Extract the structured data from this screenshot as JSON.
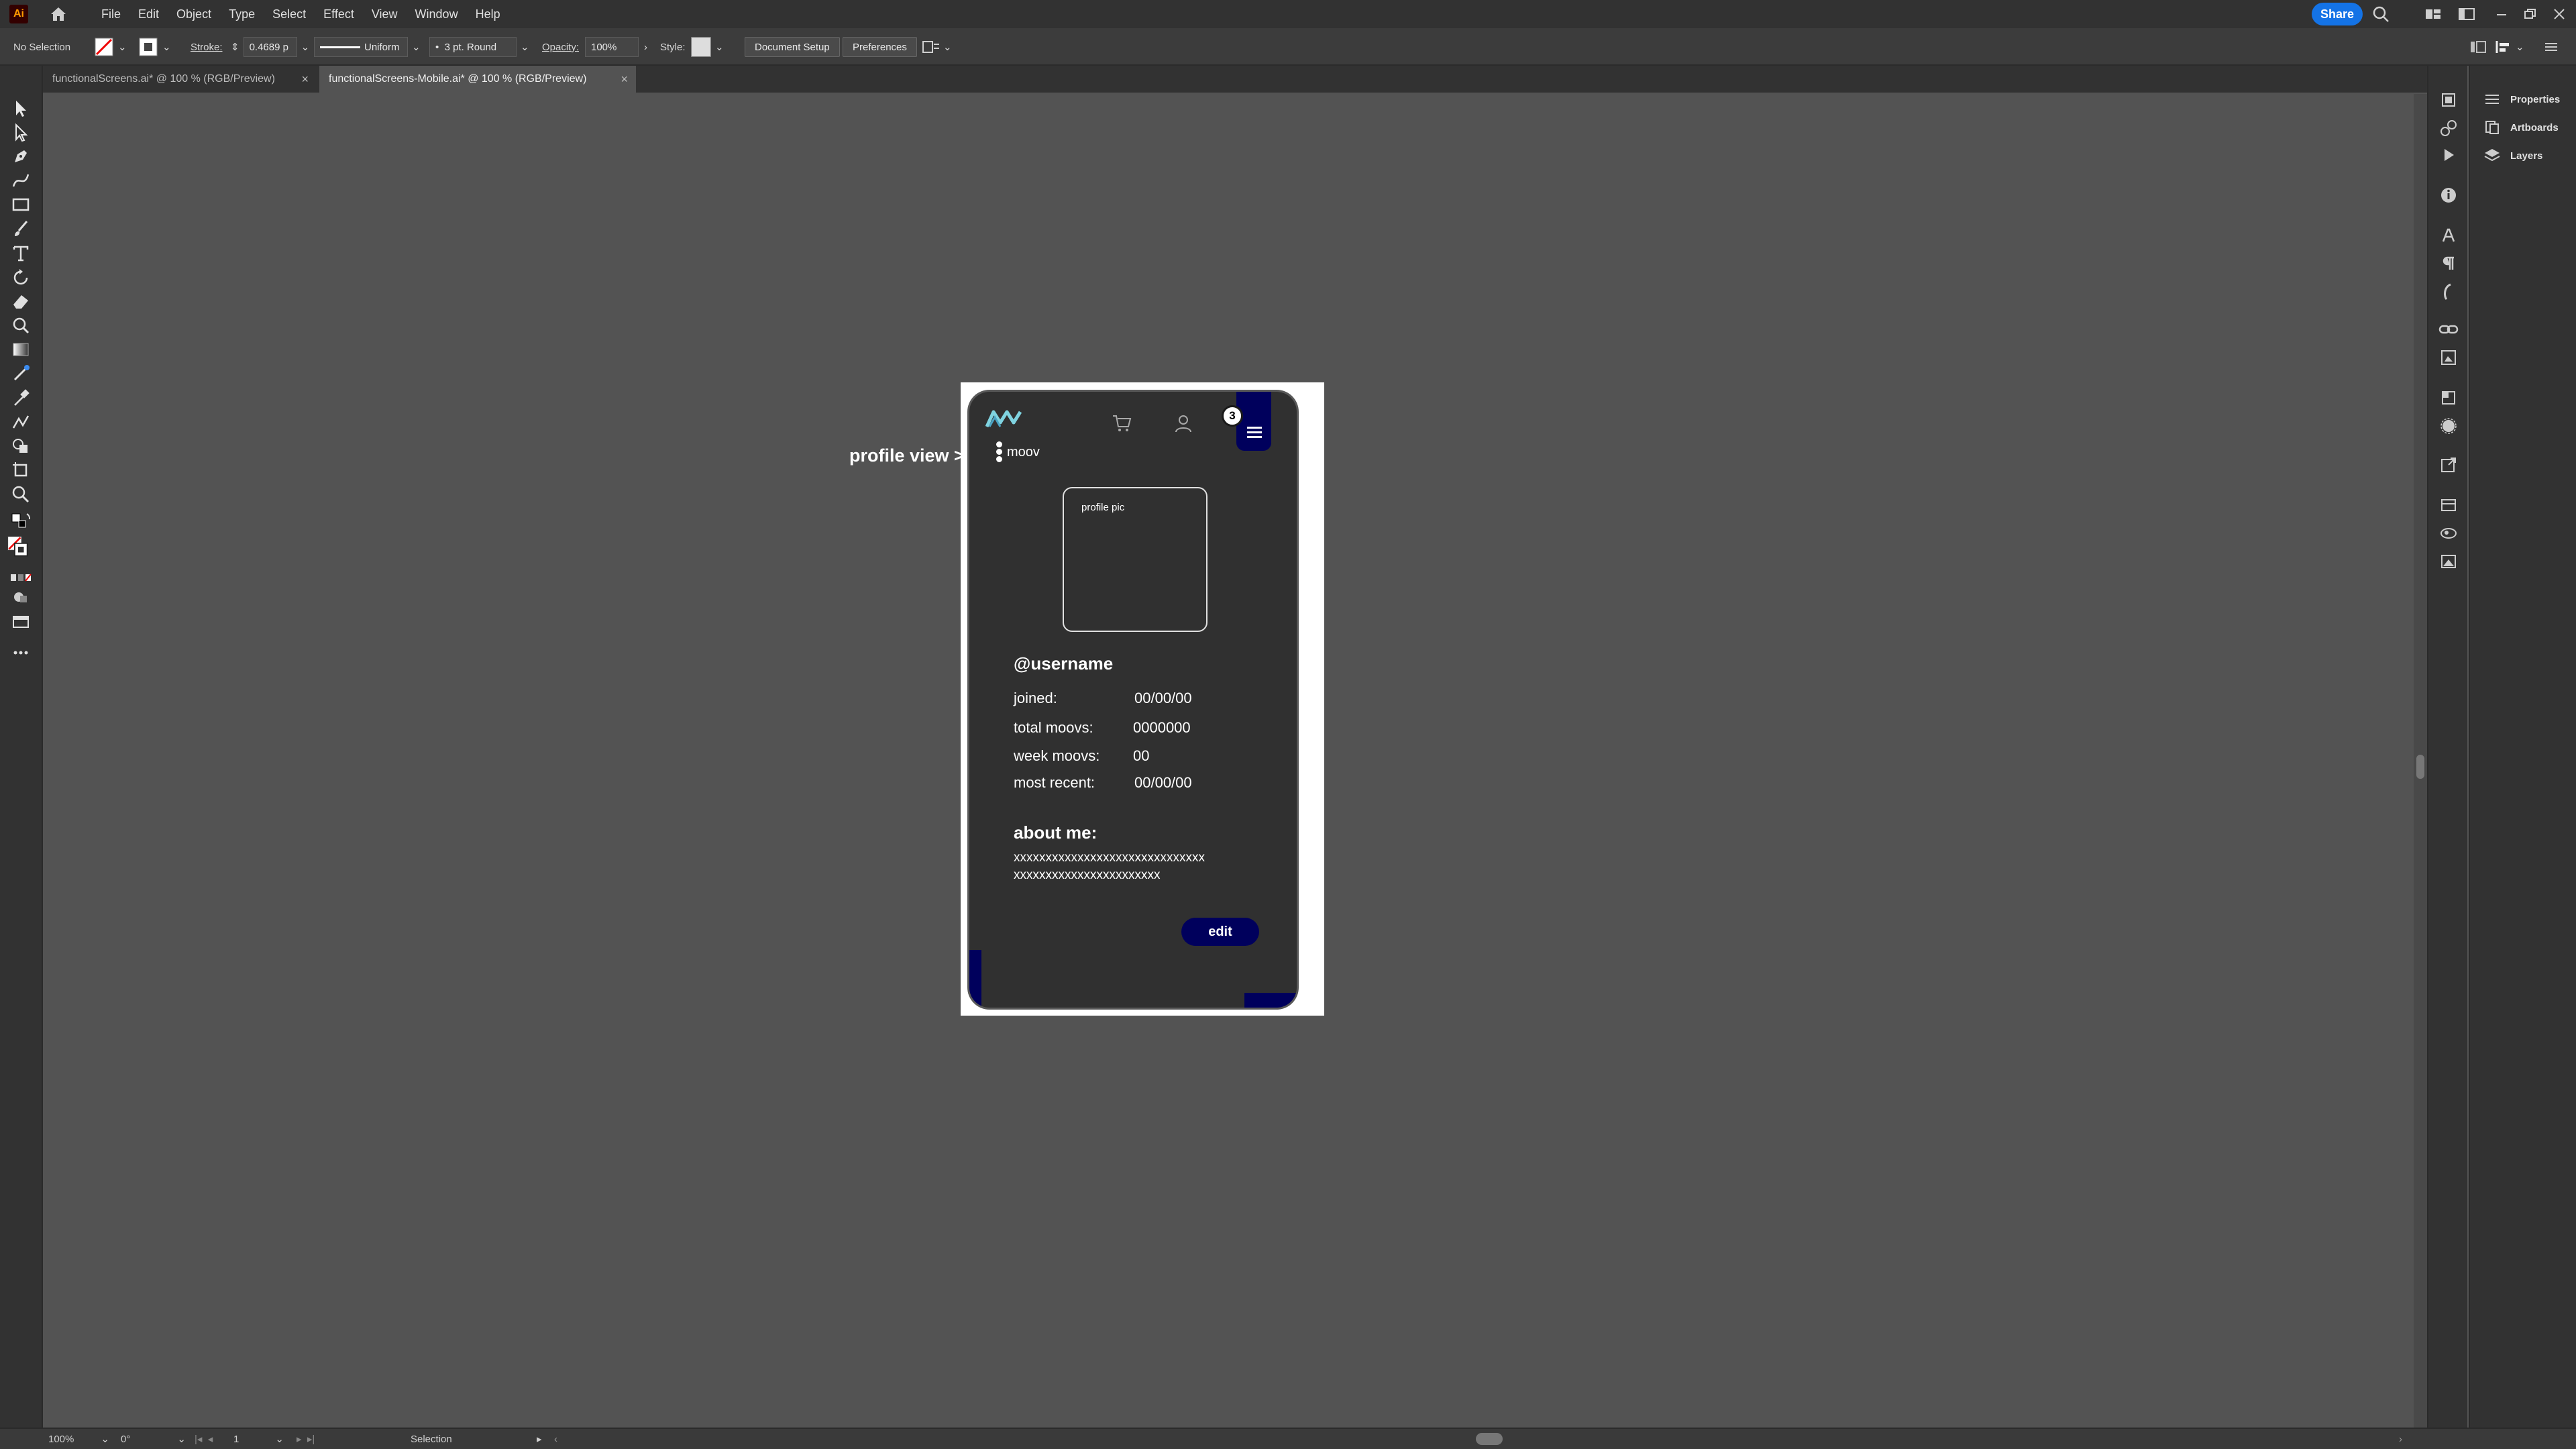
{
  "app": {
    "logo": "Ai",
    "menu": [
      "File",
      "Edit",
      "Object",
      "Type",
      "Select",
      "Effect",
      "View",
      "Window",
      "Help"
    ],
    "share_label": "Share"
  },
  "control_bar": {
    "selection": "No Selection",
    "stroke_label": "Stroke:",
    "stroke_value": "0.4689 p",
    "profile": "Uniform",
    "brush": "3 pt. Round",
    "opacity_label": "Opacity:",
    "opacity_value": "100%",
    "style_label": "Style:",
    "document_setup": "Document Setup",
    "preferences": "Preferences"
  },
  "tabs": [
    {
      "label": "functionalScreens.ai* @ 100 % (RGB/Preview)",
      "active": false
    },
    {
      "label": "functionalScreens-Mobile.ai* @ 100 % (RGB/Preview)",
      "active": true
    }
  ],
  "panels": {
    "properties": "Properties",
    "artboards": "Artboards",
    "layers": "Layers"
  },
  "status": {
    "zoom": "100%",
    "rotation": "0°",
    "artboard_number": "1",
    "tool": "Selection"
  },
  "artwork": {
    "annotation": "profile view >",
    "brand": "moov",
    "notification_count": "3",
    "profile_pic_label": "profile pic",
    "username": "@username",
    "stats": [
      {
        "label": "joined:",
        "value": "00/00/00"
      },
      {
        "label": "total moovs:",
        "value": "0000000"
      },
      {
        "label": "week moovs:",
        "value": "00"
      },
      {
        "label": "most recent:",
        "value": "00/00/00"
      }
    ],
    "about_title": "about me:",
    "about_lines": [
      "xxxxxxxxxxxxxxxxxxxxxxxxxxxxxx",
      "xxxxxxxxxxxxxxxxxxxxxxx"
    ],
    "edit_label": "edit",
    "accent_color": "#00005c"
  }
}
